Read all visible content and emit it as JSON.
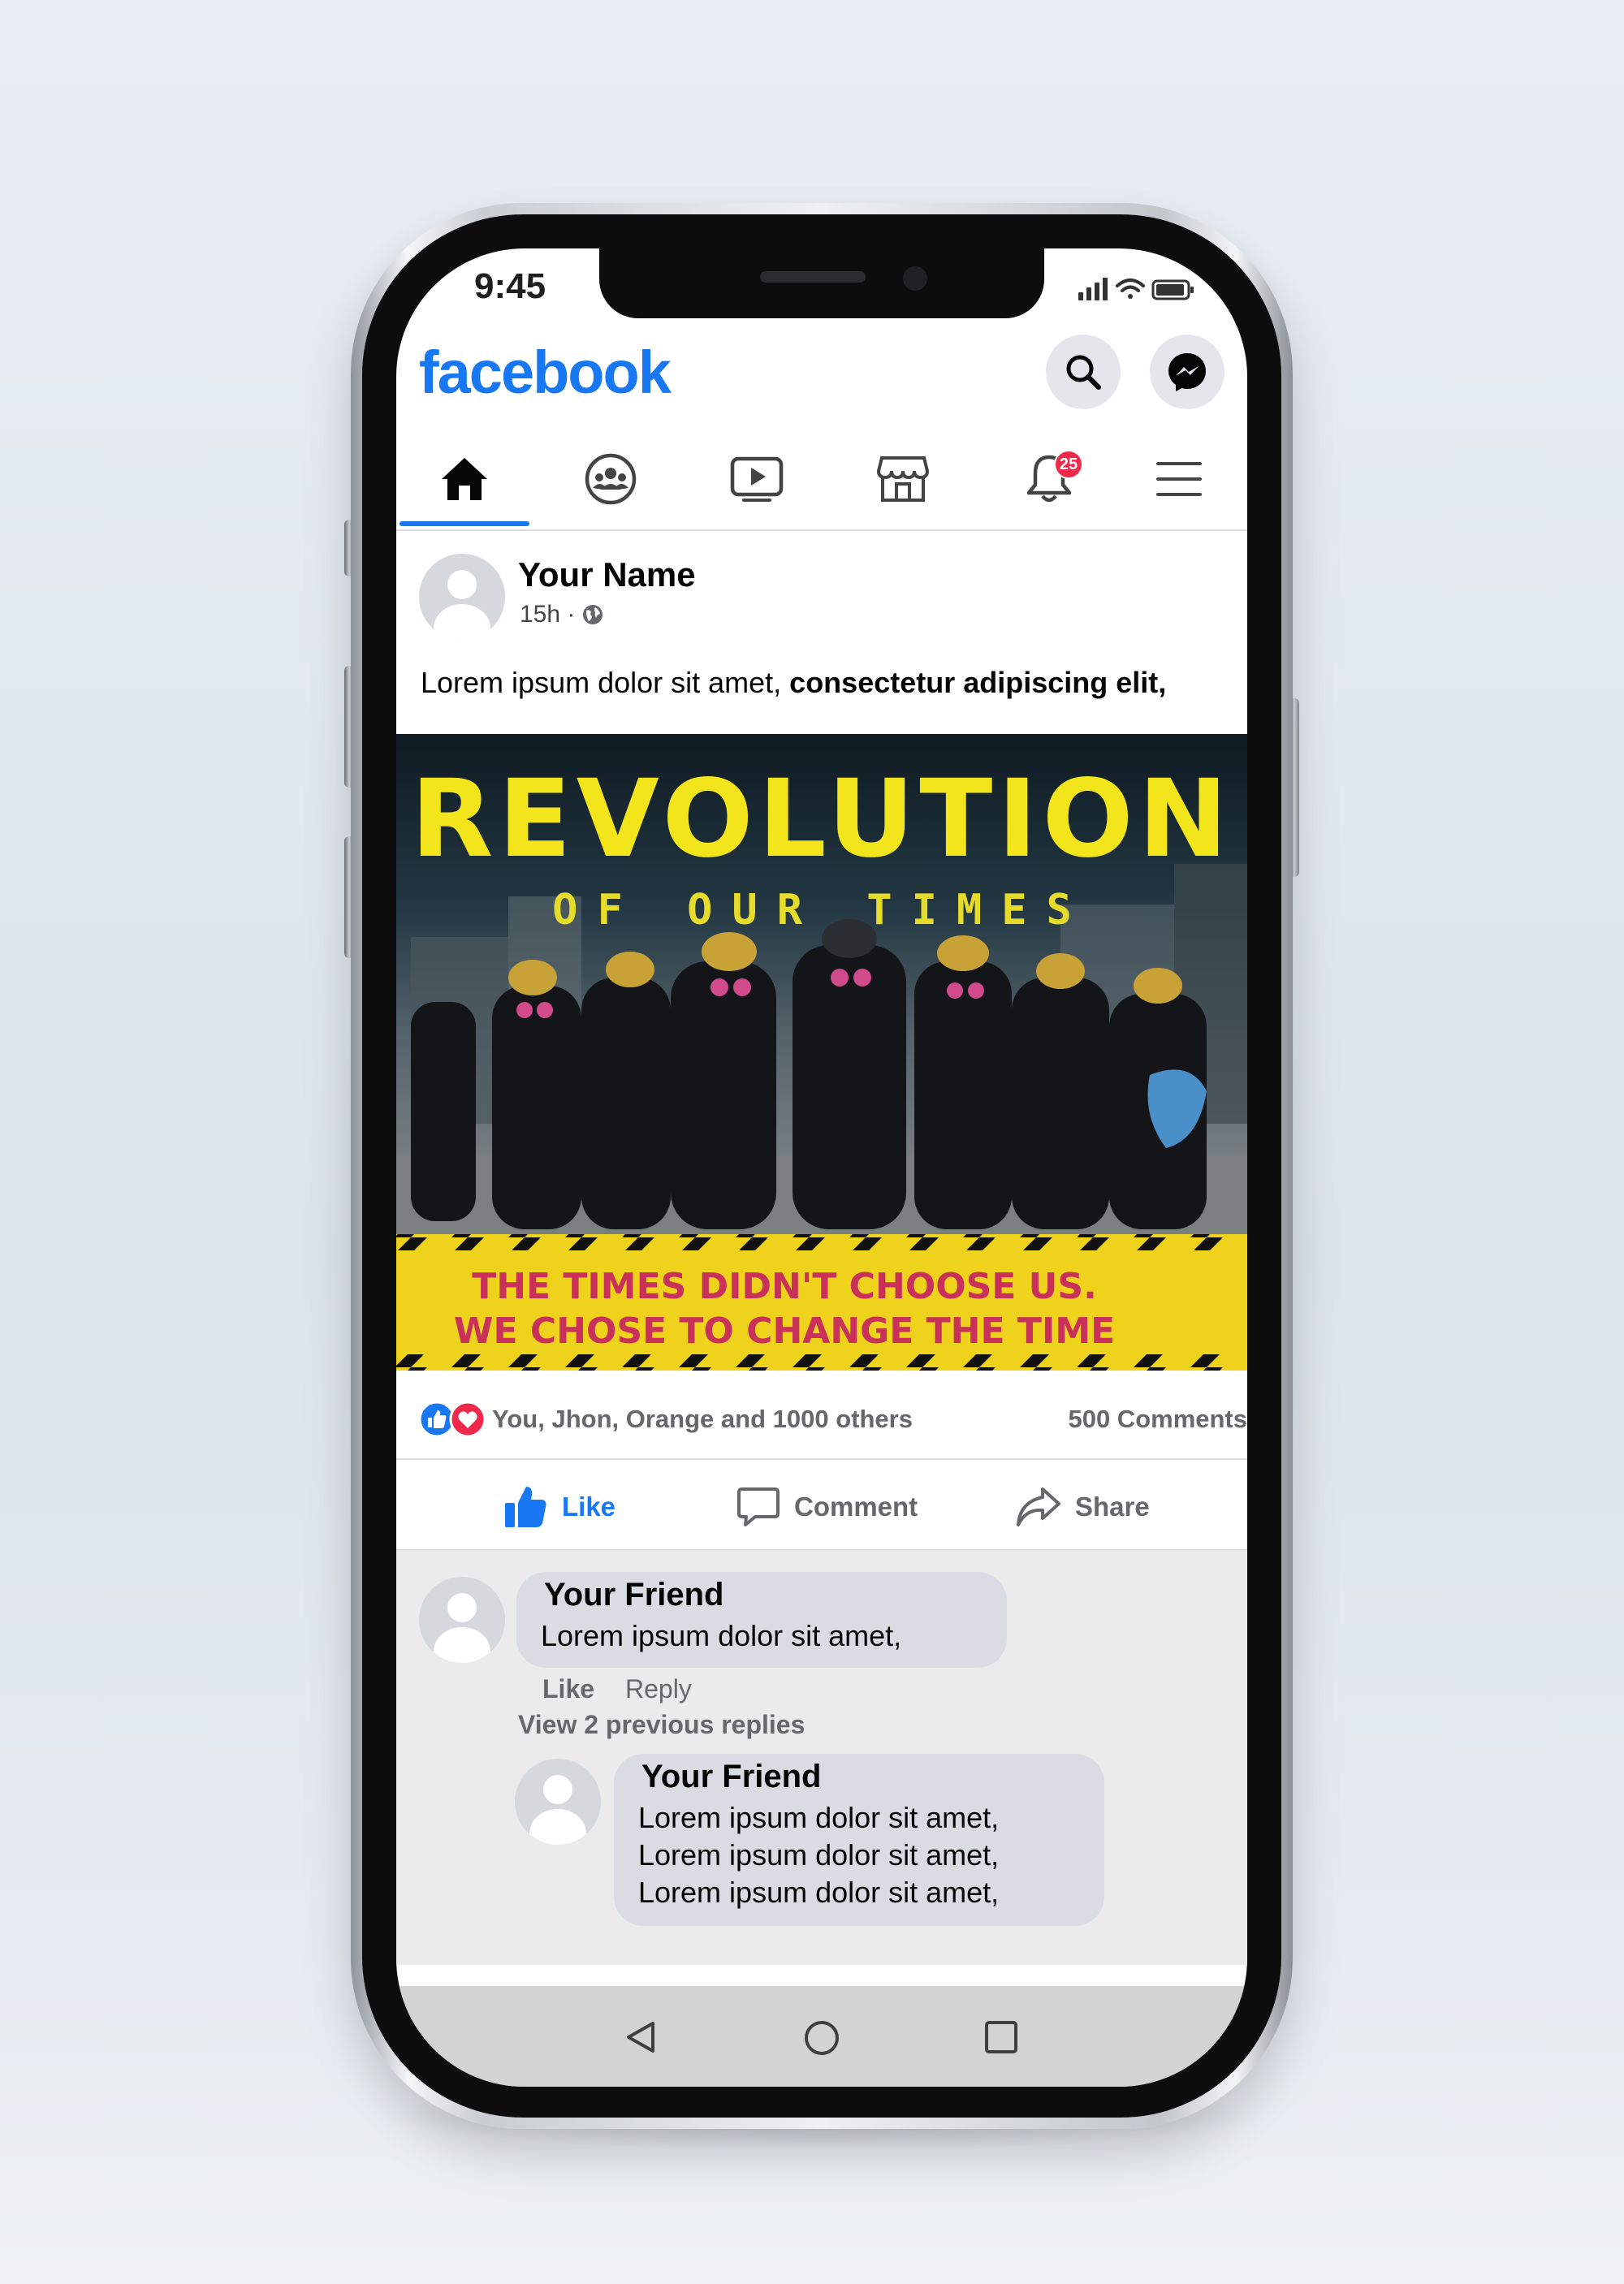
{
  "status_bar": {
    "time": "9:45"
  },
  "header": {
    "logo": "facebook",
    "search_icon": "search-icon",
    "messenger_icon": "messenger-icon"
  },
  "nav": {
    "tabs": [
      {
        "icon": "home-icon",
        "active": true
      },
      {
        "icon": "groups-icon"
      },
      {
        "icon": "watch-icon"
      },
      {
        "icon": "marketplace-icon"
      },
      {
        "icon": "bell-icon",
        "badge": "25"
      },
      {
        "icon": "menu-icon"
      }
    ]
  },
  "post": {
    "author": "Your Name",
    "time": "15h ·",
    "privacy_icon": "globe-icon",
    "text_plain": "Lorem ipsum dolor sit amet, ",
    "text_bold": "consectetur adipiscing elit,",
    "image": {
      "headline": "REVOLUTION",
      "subheadline": "OF OUR TIMES",
      "banner_line1": "THE TIMES DIDN'T CHOOSE US.",
      "banner_line2": "WE CHOSE TO CHANGE THE TIME",
      "headline_color": "#f2e51b",
      "banner_color": "#efd21c",
      "banner_text_color": "#c9305a"
    },
    "reactions_text": "You, Jhon, Orange and 1000 others",
    "comments_count": "500 Comments",
    "actions": {
      "like": "Like",
      "comment": "Comment",
      "share": "Share"
    }
  },
  "comments": [
    {
      "name": "Your Friend",
      "lines": [
        "Lorem ipsum dolor sit amet,"
      ],
      "like": "Like",
      "reply": "Reply",
      "view_replies": "View 2 previous replies"
    },
    {
      "name": "Your Friend",
      "lines": [
        "Lorem ipsum dolor sit amet,",
        "Lorem ipsum dolor sit amet,",
        "Lorem ipsum dolor sit amet,"
      ]
    }
  ],
  "colors": {
    "fb_blue": "#1877f2",
    "badge_red": "#f02849",
    "muted": "#65676b"
  }
}
